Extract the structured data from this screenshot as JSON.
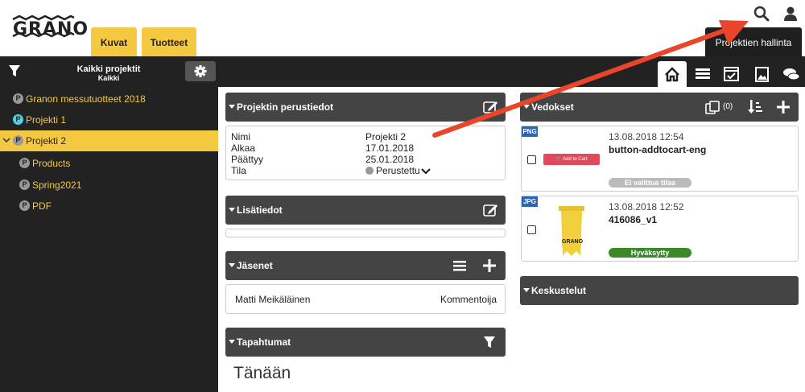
{
  "header": {
    "logo": "GRANO",
    "tabs": [
      {
        "label": "Kuvat"
      },
      {
        "label": "Tuotteet"
      }
    ],
    "admin_tab": "Projektien hallinta"
  },
  "toolbar": {
    "project_select_title": "Kaikki projektit",
    "project_select_subtitle": "Kaikki"
  },
  "sidebar": {
    "items": [
      {
        "label": "Granon messutuotteet 2018",
        "badge": "P"
      },
      {
        "label": "Projekti 1",
        "badge": "P"
      },
      {
        "label": "Projekti 2",
        "badge": "P"
      },
      {
        "label": "Products",
        "badge": "P"
      },
      {
        "label": "Spring2021",
        "badge": "P"
      },
      {
        "label": "PDF",
        "badge": "P"
      }
    ]
  },
  "basic_info": {
    "title": "Projektin perustiedot",
    "rows": [
      {
        "label": "Nimi",
        "value": "Projekti 2"
      },
      {
        "label": "Alkaa",
        "value": "17.01.2018"
      },
      {
        "label": "Päättyy",
        "value": "25.01.2018"
      },
      {
        "label": "Tila",
        "value": "Perustettu"
      }
    ]
  },
  "extra_info": {
    "title": "Lisätiedot"
  },
  "members": {
    "title": "Jäsenet",
    "rows": [
      {
        "name": "Matti Meikäläinen",
        "role": "Kommentoija"
      }
    ]
  },
  "events": {
    "title": "Tapahtumat",
    "today": "Tänään"
  },
  "proofs": {
    "title": "Vedokset",
    "count": "(0)",
    "items": [
      {
        "type": "PNG",
        "date": "13.08.2018 12:54",
        "name": "button-addtocart-eng",
        "status": "Ei valittua tilaa",
        "status_color": "#bbbbbb",
        "thumb_label": "Add to Cart"
      },
      {
        "type": "JPG",
        "date": "13.08.2018 12:52",
        "name": "416086_v1",
        "status": "Hyväksytty",
        "status_color": "#3a8a2a",
        "thumb_label": "GRANO"
      }
    ]
  },
  "discussions": {
    "title": "Keskustelut"
  },
  "colors": {
    "accent": "#f5c842",
    "dark": "#222222",
    "panel": "#444444",
    "arrow": "#e8452a"
  }
}
